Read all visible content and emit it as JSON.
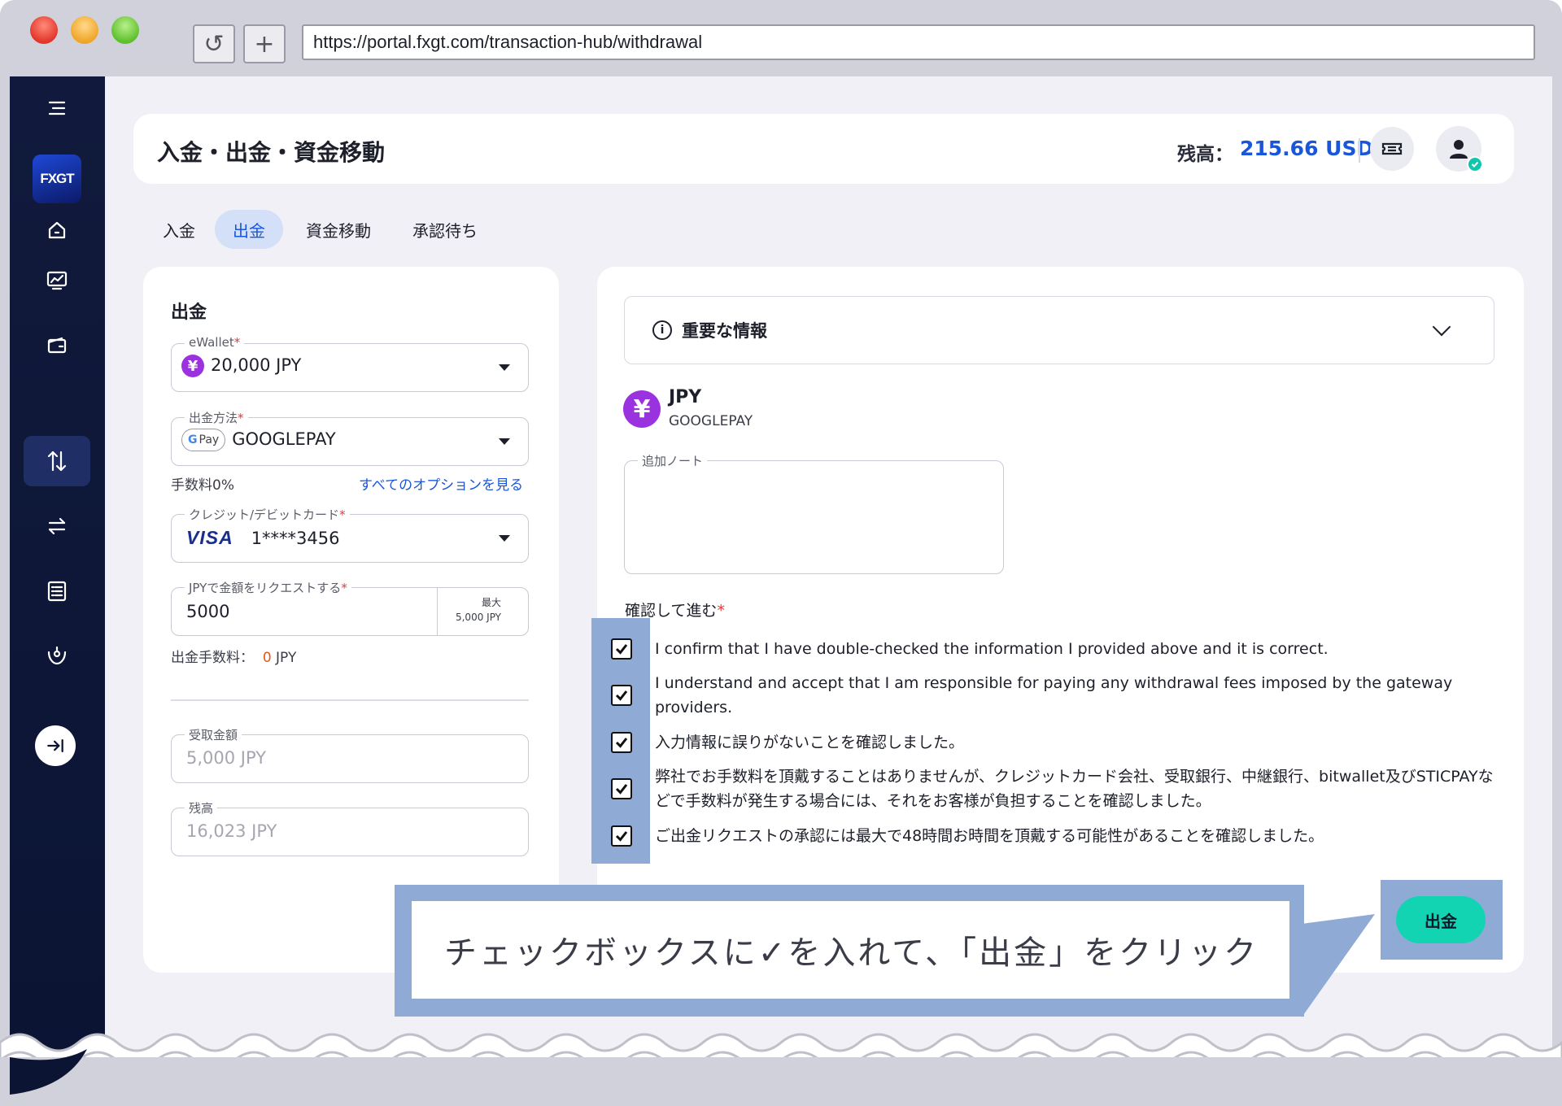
{
  "browser": {
    "url": "https://portal.fxgt.com/transaction-hub/withdrawal",
    "reload_icon": "↺",
    "new_tab_icon": "+"
  },
  "sidebar": {
    "logo_text": "FXGT",
    "items": [
      {
        "icon": "menu-icon"
      },
      {
        "icon": "home-icon"
      },
      {
        "icon": "chart-icon"
      },
      {
        "icon": "wallet-icon"
      },
      {
        "icon": "transfer-icon",
        "active": true
      },
      {
        "icon": "swap-icon"
      },
      {
        "icon": "list-icon"
      },
      {
        "icon": "support-icon"
      },
      {
        "icon": "expand-icon"
      }
    ]
  },
  "header": {
    "title": "入金・出金・資金移動",
    "balance_label": "残高：",
    "balance_value": "215.66 USD"
  },
  "tabs": [
    {
      "label": "入金",
      "active": false
    },
    {
      "label": "出金",
      "active": true
    },
    {
      "label": "資金移動",
      "active": false
    },
    {
      "label": "承認待ち",
      "active": false
    }
  ],
  "withdraw_form": {
    "title": "出金",
    "ewallet": {
      "label": "eWallet",
      "value": "20,000 JPY",
      "currency_symbol": "¥"
    },
    "method": {
      "label": "出金方法",
      "value": "GOOGLEPAY",
      "badge_g": "G",
      "badge_text": "Pay"
    },
    "fee_rate": "手数料0%",
    "see_all_link": "すべてのオプションを見る",
    "card": {
      "label": "クレジット/デビットカード",
      "brand": "VISA",
      "value": "1****3456"
    },
    "amount": {
      "label": "JPYで金額をリクエストする",
      "value": "5000",
      "max_label": "最大",
      "max_value": "5,000 JPY"
    },
    "withdraw_fee_label": "出金手数料：",
    "withdraw_fee_value": "0",
    "withdraw_fee_unit": "JPY",
    "receive": {
      "label": "受取金額",
      "value": "5,000 JPY"
    },
    "remaining": {
      "label": "残高",
      "value": "16,023 JPY"
    }
  },
  "details": {
    "info_title": "重要な情報",
    "currency_symbol": "¥",
    "currency": "JPY",
    "method": "GOOGLEPAY",
    "note_label": "追加ノート",
    "confirm_title": "確認して進む",
    "confirmations": [
      {
        "text": "I confirm that I have double-checked the information I provided above and it is correct.",
        "checked": true
      },
      {
        "text": "I understand and accept that I am responsible for paying any withdrawal fees imposed by the gateway providers.",
        "checked": true
      },
      {
        "text": "入力情報に誤りがないことを確認しました。",
        "checked": true
      },
      {
        "text": "弊社でお手数料を頂戴することはありませんが、クレジットカード会社、受取銀行、中継銀行、bitwallet及びSTICPAYなどで手数料が発生する場合には、それをお客様が負担することを確認しました。",
        "checked": true
      },
      {
        "text": "ご出金リクエストの承認には最大で48時間お時間を頂戴する可能性があることを確認しました。",
        "checked": true
      }
    ],
    "submit_label": "出金"
  },
  "callout": {
    "text": "チェックボックスに✓を入れて、「出金」をクリック"
  },
  "colors": {
    "accent": "#1a56d9",
    "submit": "#13d4b2",
    "highlight": "#90aad6",
    "sidebar": "#111a3c"
  }
}
